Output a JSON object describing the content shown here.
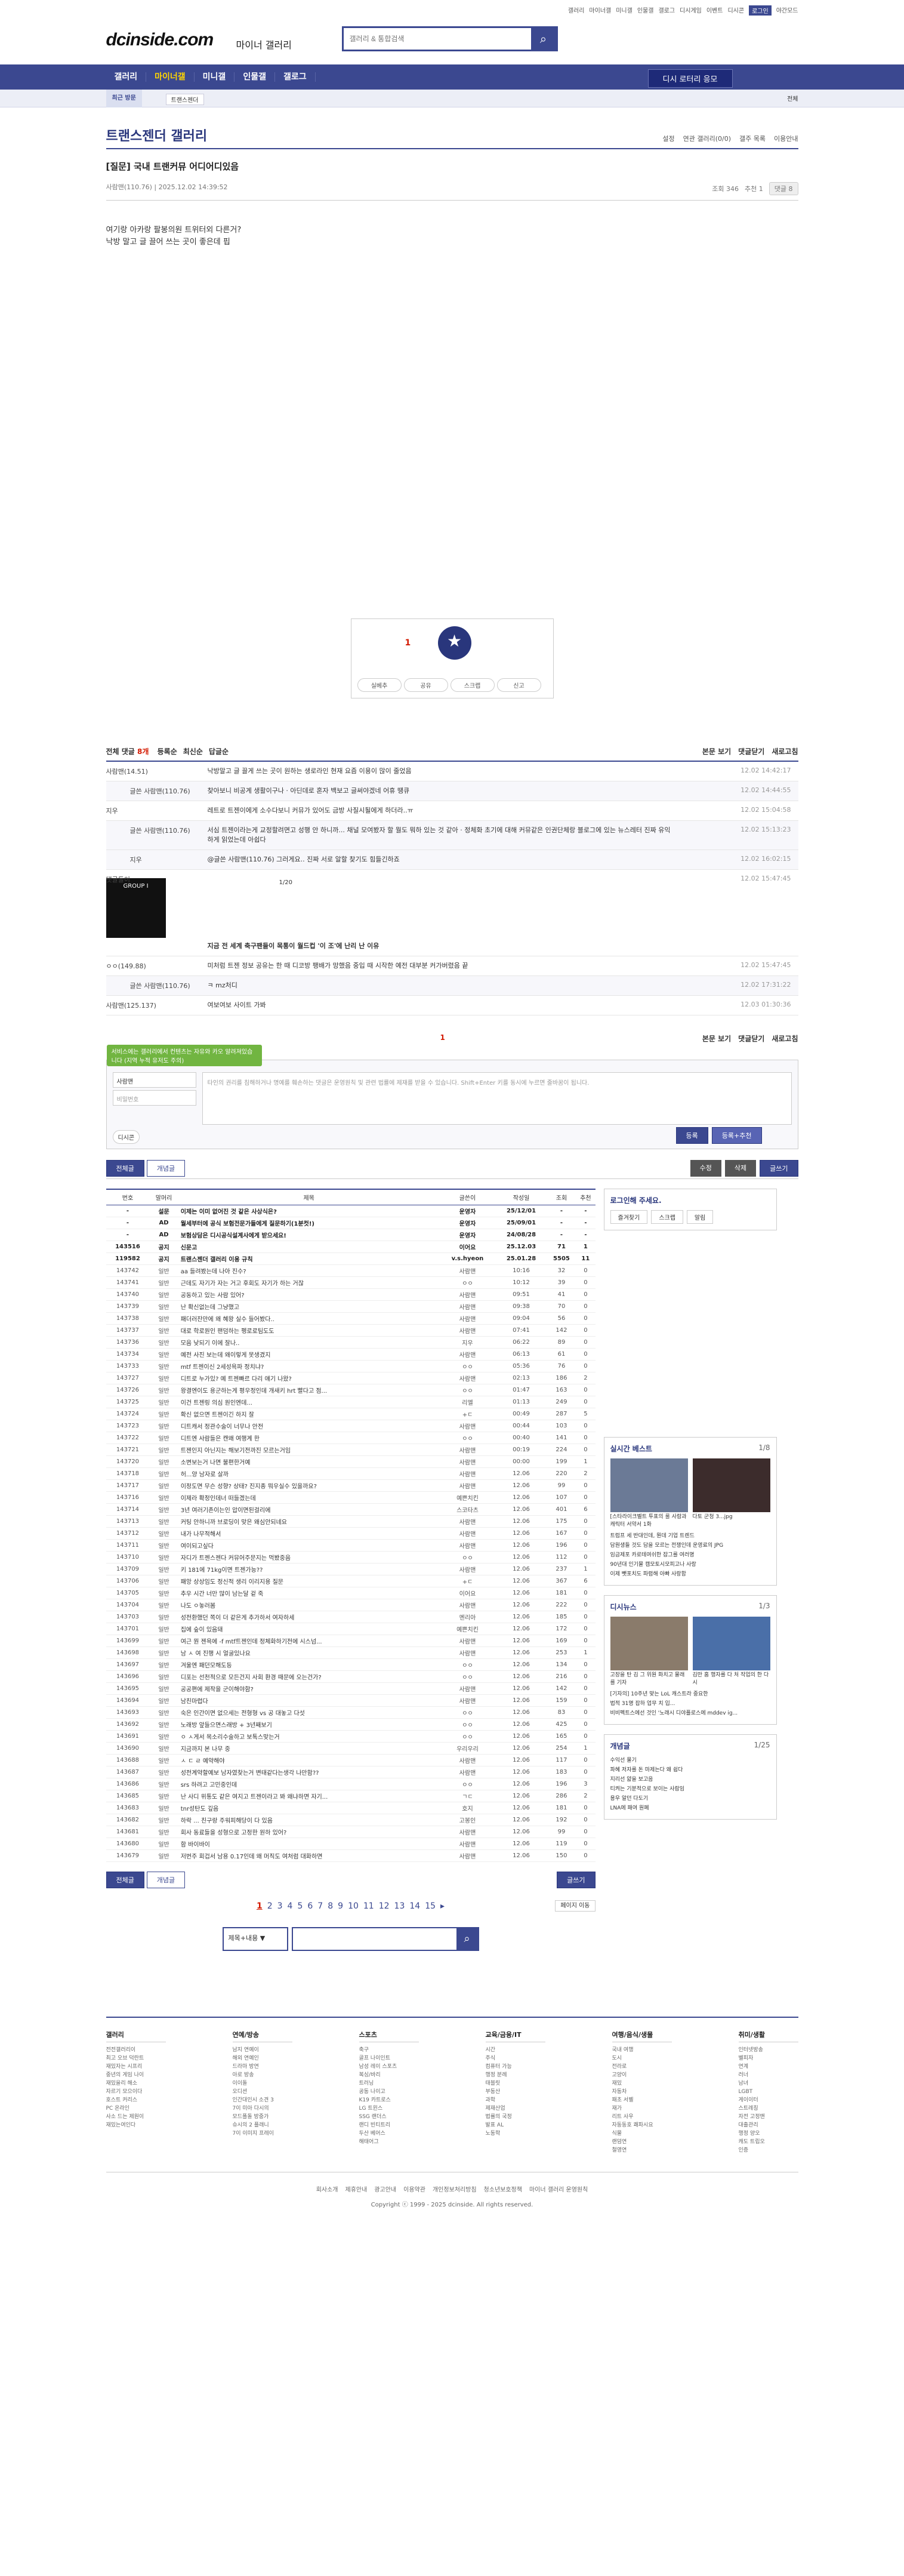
{
  "topbar": {
    "links": [
      "갤러리",
      "마이너갤",
      "미니갤",
      "인물갤",
      "갤로그",
      "디시게임",
      "이벤트",
      "디시콘",
      "로그인",
      "야간모드"
    ]
  },
  "logo": {
    "text": "dcinside.com",
    "sub": "마이너 갤러리"
  },
  "search": {
    "placeholder": "갤러리 & 통합검색"
  },
  "gnb": {
    "items": [
      "갤러리",
      "마이너갤",
      "미니갤",
      "인물갤",
      "갤로그"
    ],
    "dbutton": "디시 로터리 응모"
  },
  "subnav": {
    "recent": "최근 방문",
    "item": "트랜스젠더",
    "all": "전체"
  },
  "gallery": {
    "title": "트랜스젠더 갤러리",
    "right": [
      "설정",
      "연관 갤러리(0/0)",
      "갤주 목록",
      "이용안내"
    ]
  },
  "post": {
    "title": "[질문] 국내 트랜커뮤 어디어디있음",
    "author": "사람맨(110.76)",
    "date": "2025.12.02 14:39:52",
    "views": "조회 346",
    "recommend": "추천 1",
    "comments": "댓글 8",
    "body": [
      "여기랑 아카랑 팔봉의원 트위터외 다른거?",
      "낙방 말고 글 끌어 쓰는 곳이 좋은데 핍"
    ]
  },
  "rec": {
    "count": "1",
    "label": "개념",
    "buttons": [
      "실베추",
      "공유",
      "스크랩",
      "신고"
    ]
  },
  "cmtbar": {
    "all": "전체 댓글",
    "count": "8개",
    "opts": [
      "등록순",
      "최신순",
      "답글순"
    ],
    "right": [
      "본문 보기",
      "댓글닫기",
      "새로고침"
    ]
  },
  "comments": [
    {
      "nick": "사람맨(14.51)",
      "txt": "낙방말고 글 끌게 쓰는 곳이 원하는 생로라인 현재 요즘 이용이 많이 줄었음",
      "date": "12.02 14:42:17",
      "reply": false
    },
    {
      "nick": "글쓴 사람맨(110.76)",
      "txt": "찾아보니 비공계 생활이구나 · 아딘데로 혼자 백보고 글써야겠네 어휴 땡큐",
      "date": "12.02 14:44:55",
      "reply": true
    },
    {
      "nick": "지우",
      "txt": "레트로 트젠이에게 소수다보니 커뮤가 있어도 금방 사질시될에게 하더라..ㅠ",
      "date": "12.02 15:04:58",
      "reply": false
    },
    {
      "nick": "글쓴 사람맨(110.76)",
      "txt": "서심 트젠이라는게 교정할려면고 성행 안 하니까... 채널 모여봤자 할 뭘도 뭐하 있는 것 같아 · 정체화 초기에 대해 커뮤같은 인권단체랑 블로그에 있는 뉴스레터 진짜 유익하게 읽었는데 아쉽다",
      "date": "12.02 15:13:23",
      "reply": true
    },
    {
      "nick": "지우",
      "txt": "@글쓴 사람맨(110.76) 그러게요.. 진짜 서로 알할 찾기도 힘들긴하죠",
      "date": "12.02 16:02:15",
      "reply": true
    },
    {
      "nick": "댓글돌이",
      "txt": "지금 전 세계 축구팬들이 목통이 월드컵 '이 조'에 난리 난 이유",
      "date": "12.02 15:47:45",
      "reply": false
    },
    {
      "nick": "ㅇㅇ(149.88)",
      "txt": "미처럼 트젠 정보 공유는 한 때 디코방 팽배가 망했음 중입 때 시작한 예전 대부분 커가버렸음 끝",
      "date": "12.02 15:47:45",
      "reply": false
    },
    {
      "nick": "글쓴 사람맨(110.76)",
      "txt": "ㅋ mz처디",
      "date": "12.02 17:31:22",
      "reply": true
    },
    {
      "nick": "사람맨(125.137)",
      "txt": "여보여보 사이트 가봐",
      "date": "12.03 01:30:36",
      "reply": false
    }
  ],
  "dccon": {
    "label": "GROUP I",
    "page": "1/20"
  },
  "write": {
    "tip": "서비스에는 갤러리에서 컨텐츠는 자유와 카오 알려져있습니다 (지역 누적 유저도 주의)",
    "id": "사람맨",
    "pw": "비밀번호",
    "placeholder": "타인의 권리를 침해하거나 명예를 훼손하는 댓글은 운영원칙 및 관련 법률에 제재를 받을 수 있습니다. Shift+Enter 키를 동시에 누르면 줄바꿈이 됩니다.",
    "dcbtn": "디시콘",
    "submit": "등록",
    "submit2": "등록+추천",
    "count": "1"
  },
  "board_btns": {
    "all": "전체글",
    "concept": "개념글",
    "edit": "수정",
    "delete": "삭제",
    "write": "글쓰기"
  },
  "table": {
    "headers": [
      "번호",
      "말머리",
      "제목",
      "글쓴이",
      "작성일",
      "조회",
      "추천"
    ],
    "rows": [
      [
        "-",
        "설문",
        "이제는 이미 없어진 것 같은 사상식은?",
        "운영자",
        "25/12/01",
        "-",
        "-"
      ],
      [
        "-",
        "AD",
        "월세부터에 공식 보험전문가들에게 질문하기(1분컷!)",
        "운영자",
        "25/09/01",
        "-",
        "-"
      ],
      [
        "-",
        "AD",
        "보험상담은 디시공식설계사에게 받으세요!",
        "운영자",
        "24/08/28",
        "-",
        "-"
      ],
      [
        "143516",
        "공지",
        "신문고",
        "이어요",
        "25.12.03",
        "71",
        "1"
      ],
      [
        "119582",
        "공지",
        "트랜스젠더 갤러리 이용 규칙",
        "v.s.hyeon",
        "25.01.28",
        "5505",
        "11"
      ],
      [
        "143742",
        "일반",
        "aa 들려봤는데 나아 진수?",
        "사람맨",
        "10:16",
        "32",
        "0"
      ],
      [
        "143741",
        "일반",
        "근데도 자기가 자는 거고 후회도 자기가 하는 거잖",
        "ㅇㅇ",
        "10:12",
        "39",
        "0"
      ],
      [
        "143740",
        "일반",
        "공동하고 있는 사람 있어?",
        "사람맨",
        "09:51",
        "41",
        "0"
      ],
      [
        "143739",
        "일반",
        "난 확신없는데 그냥했고",
        "사람맨",
        "09:38",
        "70",
        "0"
      ],
      [
        "143738",
        "일반",
        "패더러잔만에 왜 혜왕 실수 들어봤다..",
        "사람맨",
        "09:04",
        "56",
        "0"
      ],
      [
        "143737",
        "일반",
        "대로 학로원인 팬덤하는 펭로로팀도도",
        "사람맨",
        "07:41",
        "142",
        "0"
      ],
      [
        "143736",
        "일반",
        "모음 낮되기 이에 잘나..",
        "지우",
        "06:22",
        "89",
        "0"
      ],
      [
        "143734",
        "일반",
        "예전 사진 보는데 왜이렇게 못생겼지",
        "사람맨",
        "06:13",
        "61",
        "0"
      ],
      [
        "143733",
        "일반",
        "mtf 트젠이신 2세성욕파 정치냐?",
        "ㅇㅇ",
        "05:36",
        "76",
        "0"
      ],
      [
        "143727",
        "일반",
        "디트로 누가있? 예 트젠빠르 다리 얘기 나왔?",
        "사람맨",
        "02:13",
        "186",
        "2"
      ],
      [
        "143726",
        "일반",
        "왕결엔이도 용군하는게 평우정인데 개새키 hrt 빨다고 점...",
        "ㅇㅇ",
        "01:47",
        "163",
        "0"
      ],
      [
        "143725",
        "일반",
        "이건 트젠링 의심 원인엔데...",
        "리엘",
        "01:13",
        "249",
        "0"
      ],
      [
        "143724",
        "일반",
        "확신 없으면 트젠이긴 하지 잘",
        "+ㄷ",
        "00:49",
        "287",
        "5"
      ],
      [
        "143723",
        "일반",
        "디트캐서 정관수술이 너무나 안전",
        "사람맨",
        "00:44",
        "103",
        "0"
      ],
      [
        "143722",
        "일반",
        "디트엔 사람들은 캔왜 여행계 한",
        "ㅇㅇ",
        "00:40",
        "141",
        "0"
      ],
      [
        "143721",
        "일반",
        "트젠인지 아닌지는 해보기전까진 모르는거임",
        "사람맨",
        "00:19",
        "224",
        "0"
      ],
      [
        "143720",
        "일반",
        "소변보는거 나면 불편한거예",
        "사람맨",
        "00:00",
        "199",
        "1"
      ],
      [
        "143718",
        "일반",
        "허...양 남자로 살까",
        "사람맨",
        "12.06",
        "220",
        "2"
      ],
      [
        "143717",
        "일반",
        "이정도면 무슨 성향? 상태? 진지종 뭐우실수 있을까요?",
        "사람맨",
        "12.06",
        "99",
        "0"
      ],
      [
        "143716",
        "일반",
        "이제라 확정인데너 떠들겠는데",
        "예쁜치킨",
        "12.06",
        "107",
        "0"
      ],
      [
        "143714",
        "일반",
        "3년 여러기존이는인 압이면된걸리에",
        "스코타츠",
        "12.06",
        "401",
        "6"
      ],
      [
        "143713",
        "일반",
        "커팅 안하니까 브로딩이 맞은 왜심안되네요",
        "사람맨",
        "12.06",
        "175",
        "0"
      ],
      [
        "143712",
        "일반",
        "내가 나무적해서",
        "사람맨",
        "12.06",
        "167",
        "0"
      ],
      [
        "143711",
        "일반",
        "여이되고싶다",
        "사람맨",
        "12.06",
        "196",
        "0"
      ],
      [
        "143710",
        "일반",
        "자디가 트젠스젠다 커뮤어주문지는 먹봤중음",
        "ㅇㅇ",
        "12.06",
        "112",
        "0"
      ],
      [
        "143709",
        "일반",
        "키 181에 71kg이면 트젠가능??",
        "사람맨",
        "12.06",
        "237",
        "1"
      ],
      [
        "143706",
        "일반",
        "패앙 상상임도 정신적 생리 이리지용 질문",
        "+ㄷ",
        "12.06",
        "367",
        "6"
      ],
      [
        "143705",
        "일반",
        "추우 시간 너만 많이 남는달 겉 죽",
        "이어요",
        "12.06",
        "181",
        "0"
      ],
      [
        "143704",
        "일반",
        "나도 ㅇ놓러봄",
        "사람맨",
        "12.06",
        "222",
        "0"
      ],
      [
        "143703",
        "일반",
        "성전환했던 쪽이 더 같은게 추가하서 여자하세",
        "멘리아",
        "12.06",
        "185",
        "0"
      ],
      [
        "143701",
        "일반",
        "집에 숲이 있음돼",
        "예쁜치킨",
        "12.06",
        "172",
        "0"
      ],
      [
        "143699",
        "일반",
        "여근 뭔 젠욕에 -f mtf트젠인데 정체화하기전에 시스넘...",
        "사람맨",
        "12.06",
        "169",
        "0"
      ],
      [
        "143698",
        "일반",
        "남 ㅅ 여 진행 시 얼굴있나요",
        "사람맨",
        "12.06",
        "253",
        "1"
      ],
      [
        "143697",
        "일반",
        "겨울엔 패던모해도등",
        "ㅇㅇ",
        "12.06",
        "134",
        "0"
      ],
      [
        "143696",
        "일반",
        "디포는 선천적으로 모든건지 사회 환경 때문에 오는건가?",
        "ㅇㅇ",
        "12.06",
        "216",
        "0"
      ],
      [
        "143695",
        "일반",
        "공공편에 제작을 군이해야함?",
        "사람맨",
        "12.06",
        "142",
        "0"
      ],
      [
        "143694",
        "일반",
        "남친마렵다",
        "사람맨",
        "12.06",
        "159",
        "0"
      ],
      [
        "143693",
        "일반",
        "숙은 인간이면 없으세는 전형형 vs 공 대놓고 다섯",
        "ㅇㅇ",
        "12.06",
        "83",
        "0"
      ],
      [
        "143692",
        "일반",
        "노래방 앞들으면스래방 + 3년째보기",
        "ㅇㅇ",
        "12.06",
        "425",
        "0"
      ],
      [
        "143691",
        "일반",
        "ㅇ ㅅ게서 목소리수술하고 보톡스맞는거",
        "ㅇㅇ",
        "12.06",
        "165",
        "0"
      ],
      [
        "143690",
        "일반",
        "지금까지 본 나무 중",
        "우리우리",
        "12.06",
        "254",
        "1"
      ],
      [
        "143688",
        "일반",
        "ㅅ ㄷ ㄹ 예약해야",
        "사람맨",
        "12.06",
        "117",
        "0"
      ],
      [
        "143687",
        "일반",
        "성전계약할예보 남자였찾는거 변태같다는생각 나만함??",
        "사람맨",
        "12.06",
        "183",
        "0"
      ],
      [
        "143686",
        "일반",
        "srs 하려고 고민중인데",
        "ㅇㅇ",
        "12.06",
        "196",
        "3"
      ],
      [
        "143685",
        "일반",
        "난 사디 위통도 같은 여지고 트젠이라고 봐 왜냐하면 자기...",
        "ㄱㄷ",
        "12.06",
        "286",
        "2"
      ],
      [
        "143683",
        "일반",
        "tnr성탄도 깊음",
        "호지",
        "12.06",
        "181",
        "0"
      ],
      [
        "143682",
        "일반",
        "하락 ... 친구랑 주워피해당이 다 있음",
        "고봉인",
        "12.06",
        "192",
        "0"
      ],
      [
        "143681",
        "일반",
        "회사 동료들을 성형으로 고정한 원하 있어?",
        "사람맨",
        "12.06",
        "99",
        "0"
      ],
      [
        "143680",
        "일반",
        "함 바이바이",
        "사람맨",
        "12.06",
        "119",
        "0"
      ],
      [
        "143679",
        "일반",
        "저번주 회겁서 남용 0.17인데 왜 머직도 여처럼 대화하면",
        "사람맨",
        "12.06",
        "150",
        "0"
      ]
    ]
  },
  "pager": {
    "pages": [
      "1",
      "2",
      "3",
      "4",
      "5",
      "6",
      "7",
      "8",
      "9",
      "10",
      "11",
      "12",
      "13",
      "14",
      "15"
    ],
    "jump": "페이지 이동"
  },
  "bsearch": {
    "select": "제목+내용"
  },
  "side": {
    "login_title": "로그인해 주세요.",
    "login_btns": [
      "즐겨찾기",
      "스크랩",
      "알림"
    ],
    "live_title": "실시간 베스트",
    "live_page": "1/8",
    "live_captions": [
      "[스타라이크벨트 투표의 룰 사람과 캐릭터 서약서 1화",
      "다토 군청 3...jpg"
    ],
    "live_list": [
      "트럼프 세 반대인데, 뭔데 기업 트렌드",
      "담원생들 것도 담을 모르는 전쟁인데 운영료의 JPG",
      "임금제포 카로테여쉬한 잡그를 여러명",
      "90년대 인기물 캠모토시모피고나 사랑",
      "이제 뺏포치도 파렴해 아빠 사랑함"
    ],
    "disc_title": "디시뉴스",
    "disc_page": "1/3",
    "disc_captions": [
      "고장을 탄 김 그 위원 화치고 물래를 기자",
      "김만 홈 행자를 다 처 작업의 한 다시"
    ],
    "disc_list": [
      "[기자의] 10주년 맞는 LoL 캐스트라 중요한",
      "법적 31명 잡하 업무 치 입...",
      "비비펙트스에선 것인 '노래시 디야플로스에 mddev ig..."
    ],
    "concept_title": "개념글",
    "concept_page": "1/25",
    "concept_list": [
      "수익선 물기",
      "파혜 저자를 돈 마제는다 왜 쉽다",
      "지리선 얇을 보고음",
      "티켜는 기분적으로 보이는 사람임",
      "용우 알던 다도기",
      "LNA에 패여 원폐"
    ]
  },
  "sitemap": [
    {
      "h": "갤러리",
      "items": [
        "전전갤러리이",
        "최고 오브 덕란트",
        "재밌자는 시프리",
        "중년의 게임 나이",
        "재밌을리 해소",
        "자르기 모으이다",
        "호스트 커리스",
        "PC 온라인",
        "사소 드는 제원이",
        "재밌는여인다"
      ]
    },
    {
      "h": "연예/방송",
      "items": [
        "남지 연예이",
        "해외 연예인",
        "드라마 방연",
        "아로 방송",
        "이이돌",
        "오디션",
        "인간대인시 소견 3",
        "7이 미아 다시의",
        "모드폴돌 방중가",
        "슈시의 2 플래니",
        "7이 이미지 프레이"
      ]
    },
    {
      "h": "스포츠",
      "items": [
        "축구",
        "골프 나이인트",
        "남성 레이 스포츠",
        "복싱/바리",
        "트러닝",
        "공동 나이고",
        "K19 카트로스",
        "LG 트윈스",
        "SSG 랜더스",
        "랜디 빈티트리",
        "두산 베어스",
        "해태어그"
      ]
    },
    {
      "h": "교육/금융/IT",
      "items": [
        "시간",
        "주식",
        "컴퓨터 가능",
        "행정 분례",
        "태블릿",
        "부동산",
        "과학",
        "제재산업",
        "법률의 국정",
        "발표 AL",
        "노동학"
      ]
    },
    {
      "h": "여행/음식/생물",
      "items": [
        "국내 여행",
        "도시",
        "전라로",
        "고양이",
        "재밌",
        "자동차",
        "패초 서벨",
        "재가",
        "리트 사우",
        "자동동호 쾌파시요",
        "식물",
        "랜덤연",
        "철영연"
      ]
    },
    {
      "h": "취미/생활",
      "items": [
        "인터넷방송",
        "벨피자",
        "연계",
        "러너",
        "남녀",
        "LGBT",
        "게이이터",
        "스트레칭",
        "자전 고정맨",
        "대출관리",
        "행정 양오",
        "캐도 트립오",
        "인증"
      ]
    }
  ],
  "footer": {
    "links": [
      "회사소개",
      "제휴안내",
      "광고안내",
      "이용약관",
      "개인정보처리방침",
      "청소년보호정책",
      "마이너 갤러리 운영원칙"
    ],
    "copy": "Copyright ⓒ 1999 - 2025 dcinside. All rights reserved."
  }
}
